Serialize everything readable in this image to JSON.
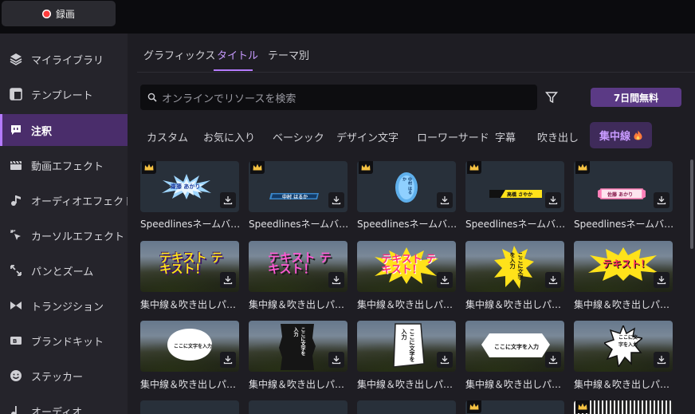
{
  "record": {
    "label": "録画"
  },
  "sidebar": {
    "items": [
      {
        "label": "マイライブラリ",
        "icon": "layers-icon"
      },
      {
        "label": "テンプレート",
        "icon": "template-icon"
      },
      {
        "label": "注釈",
        "icon": "comment-icon",
        "active": true
      },
      {
        "label": "動画エフェクト",
        "icon": "clapper-icon"
      },
      {
        "label": "オーディオエフェクト",
        "icon": "music-note-icon"
      },
      {
        "label": "カーソルエフェクト",
        "icon": "cursor-click-icon"
      },
      {
        "label": "パンとズーム",
        "icon": "expand-icon"
      },
      {
        "label": "トランジション",
        "icon": "transition-icon"
      },
      {
        "label": "ブランドキット",
        "icon": "brand-kit-icon"
      },
      {
        "label": "ステッカー",
        "icon": "smiley-icon"
      },
      {
        "label": "オーディオ",
        "icon": "audio-icon"
      }
    ]
  },
  "tabs": [
    "グラフィックス",
    "タイトル",
    "テーマ別"
  ],
  "active_tab": "タイトル",
  "search": {
    "placeholder": "オンラインでリソースを検索"
  },
  "trial_button": "7日間無料",
  "categories": [
    "カスタム",
    "お気に入り",
    "ベーシック",
    "デザイン文字",
    "ローワーサード",
    "字幕",
    "吹き出し",
    "集中線"
  ],
  "active_category": "集中線",
  "grid": {
    "row1_caption": "Speedlinesネームバータ...",
    "row2_caption": "集中線＆吹き出しパー...",
    "row3_caption": "集中線＆吹き出しパー...",
    "row1_texts": [
      "齋藤 あかり",
      "中村 はるか",
      "中村 はるか",
      "高橋 さやか",
      "佐藤 あかり"
    ],
    "row2_texts": [
      "テキスト テキスト！",
      "テキスト テキスト！",
      "テキスト テキスト！",
      "ここに文字を入力",
      "テキスト！"
    ],
    "row3_texts": [
      "ここに文字を入力",
      "ここに文字を入力",
      "ここに文字を入力",
      "ここに文字を入力",
      "ここに文字を入力"
    ]
  },
  "colors": {
    "accent": "#b57bff",
    "active_bg": "#4a2d6b",
    "trial_bg": "#5b3a85",
    "record": "#ff3b3b"
  }
}
